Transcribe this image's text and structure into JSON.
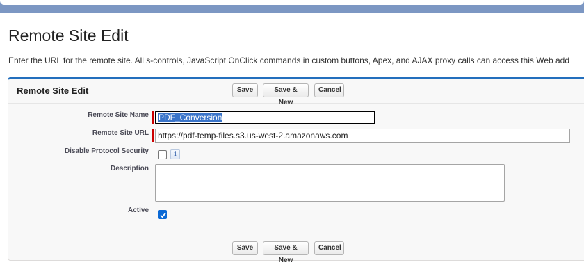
{
  "page": {
    "title": "Remote Site Edit",
    "instructions": "Enter the URL for the remote site. All s-controls, JavaScript OnClick commands in custom buttons, Apex, and AJAX proxy calls can access this Web add"
  },
  "panel": {
    "title": "Remote Site Edit"
  },
  "buttons": {
    "save": "Save",
    "save_new": "Save & New",
    "cancel": "Cancel"
  },
  "form": {
    "remote_site_name": {
      "label": "Remote Site Name",
      "value": "PDF_Conversion",
      "required": true
    },
    "remote_site_url": {
      "label": "Remote Site URL",
      "value": "https://pdf-temp-files.s3.us-west-2.amazonaws.com",
      "required": true
    },
    "disable_protocol_security": {
      "label": "Disable Protocol Security",
      "checked": false,
      "info_icon": "info-icon"
    },
    "description": {
      "label": "Description",
      "value": ""
    },
    "active": {
      "label": "Active",
      "checked": true
    }
  },
  "colors": {
    "banner": "#7c97c3",
    "panel_accent": "#236fbd",
    "required": "#cc0000",
    "checkbox_checked": "#0b69d5",
    "selection": "#3a74c9"
  }
}
